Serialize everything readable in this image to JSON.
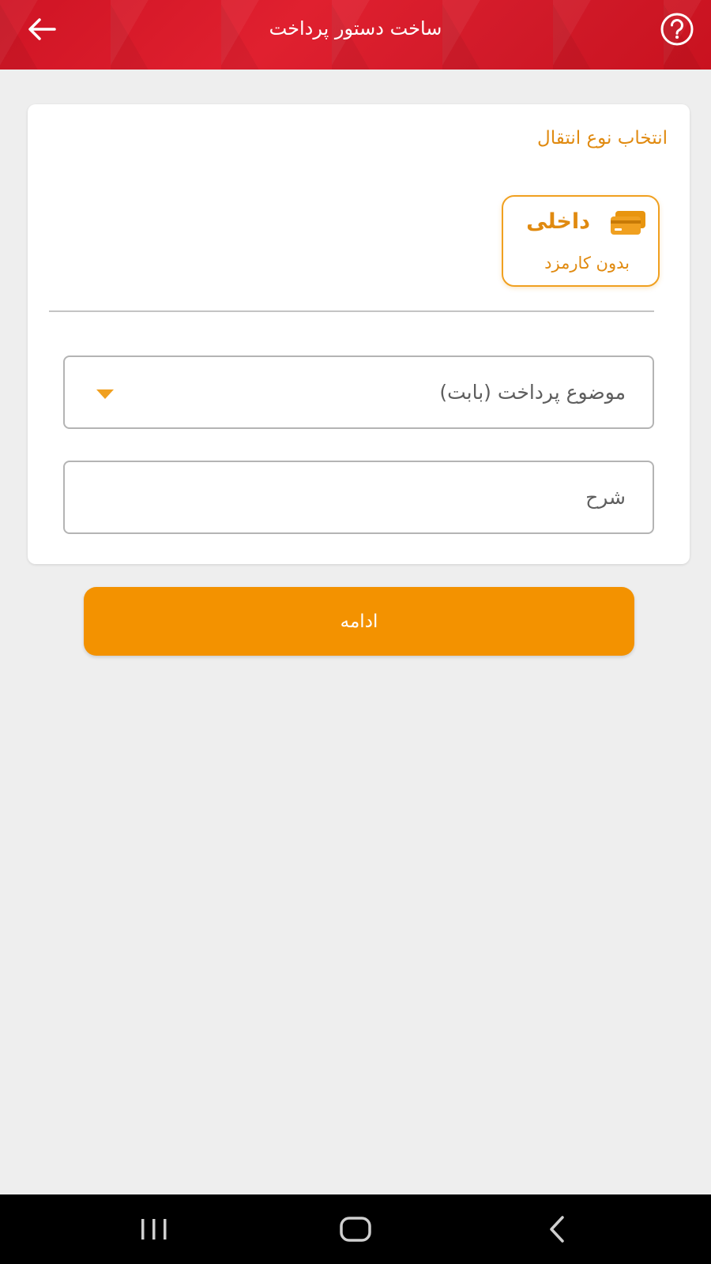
{
  "header": {
    "title": "ساخت دستور پرداخت",
    "back_icon": "arrow-left-icon",
    "help_icon": "help-circle-icon",
    "background_color": "#d11a29"
  },
  "transfer": {
    "section_title": "انتخاب نوع انتقال",
    "options": [
      {
        "label": "داخلی",
        "sub_label": "بدون کارمزد",
        "icon": "credit-card-icon",
        "selected": true
      }
    ]
  },
  "form": {
    "subject_placeholder": "موضوع پرداخت (بابت)",
    "description_placeholder": "شرح"
  },
  "actions": {
    "continue_label": "ادامه",
    "continue_color": "#f39200"
  },
  "accent_color": "#e08a10",
  "system_nav": {
    "recents_icon": "recents-icon",
    "home_icon": "home-icon",
    "back_icon": "nav-back-icon"
  }
}
